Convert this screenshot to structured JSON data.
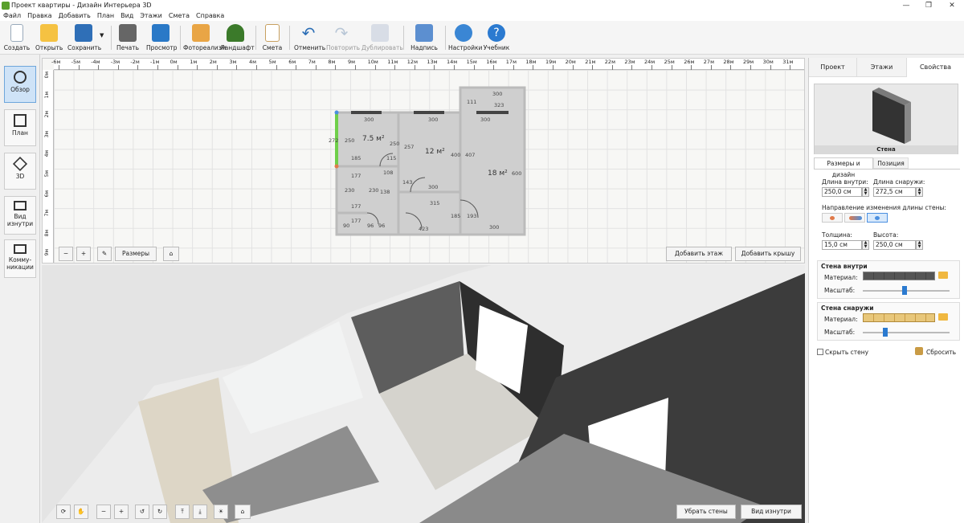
{
  "window": {
    "title": "Проект квартиры - Дизайн Интерьера 3D",
    "minimize": "—",
    "restore": "❐",
    "close": "✕"
  },
  "menu": [
    "Файл",
    "Правка",
    "Добавить",
    "План",
    "Вид",
    "Этажи",
    "Смета",
    "Справка"
  ],
  "toolbar": {
    "create": "Создать",
    "open": "Открыть",
    "save": "Сохранить",
    "print": "Печать",
    "preview": "Просмотр",
    "photorealism": "Фотореализм",
    "landscape": "Ландшафт",
    "estimate": "Смета",
    "undo": "Отменить",
    "redo": "Повторить",
    "duplicate": "Дублировать",
    "label": "Надпись",
    "settings": "Настройки",
    "tutorial": "Учебник"
  },
  "side": {
    "overview": "Обзор",
    "plan": "План",
    "3d": "3D",
    "inside_line1": "Вид",
    "inside_line2": "изнутри",
    "comm_line1": "Комму-",
    "comm_line2": "никации"
  },
  "ruler": {
    "top": [
      "-6м",
      "-5м",
      "-4м",
      "-3м",
      "-2м",
      "-1м",
      "0м",
      "1м",
      "2м",
      "3м",
      "4м",
      "5м",
      "6м",
      "7м",
      "8м",
      "9м",
      "10м",
      "11м",
      "12м",
      "13м",
      "14м",
      "15м",
      "16м",
      "17м",
      "18м",
      "19м",
      "20м",
      "21м",
      "22м",
      "23м",
      "24м",
      "25м",
      "26м",
      "27м",
      "28м",
      "29м",
      "30м",
      "31м"
    ],
    "left": [
      "0м",
      "1м",
      "2м",
      "3м",
      "4м",
      "5м",
      "6м",
      "7м",
      "8м",
      "9м"
    ]
  },
  "plan": {
    "rooms": [
      {
        "area": "7.5 м²"
      },
      {
        "area": "12 м²"
      },
      {
        "area": "18 м²"
      }
    ],
    "dims": [
      "300",
      "300",
      "300",
      "300",
      "323",
      "111",
      "272",
      "250",
      "250",
      "257",
      "400",
      "407",
      "600",
      "185",
      "115",
      "177",
      "108",
      "143",
      "300",
      "315",
      "230",
      "230",
      "138",
      "177",
      "185",
      "193",
      "300",
      "90",
      "177",
      "96",
      "96",
      "423"
    ],
    "sizes_button": "Размеры",
    "add_floor": "Добавить этаж",
    "add_roof": "Добавить крышу"
  },
  "view3d": {
    "remove_walls": "Убрать стены",
    "inside_view": "Вид изнутри"
  },
  "panel": {
    "tabs": [
      "Проект",
      "Этажи",
      "Свойства"
    ],
    "preview_caption": "Стена",
    "subtabs": [
      "Размеры и дизайн",
      "Позиция"
    ],
    "len_in_label": "Длина внутри:",
    "len_in": "250,0 см",
    "len_out_label": "Длина снаружи:",
    "len_out": "272,5 см",
    "direction_label": "Направление изменения длины стены:",
    "thick_label": "Толщина:",
    "thick": "15,0 см",
    "height_label": "Высота:",
    "height": "250,0 см",
    "inside_title": "Стена внутри",
    "outside_title": "Стена снаружи",
    "material": "Материал:",
    "scale": "Масштаб:",
    "hide_wall": "Скрыть стену",
    "reset": "Сбросить",
    "scale_inside": 0.48,
    "scale_outside": 0.26
  }
}
